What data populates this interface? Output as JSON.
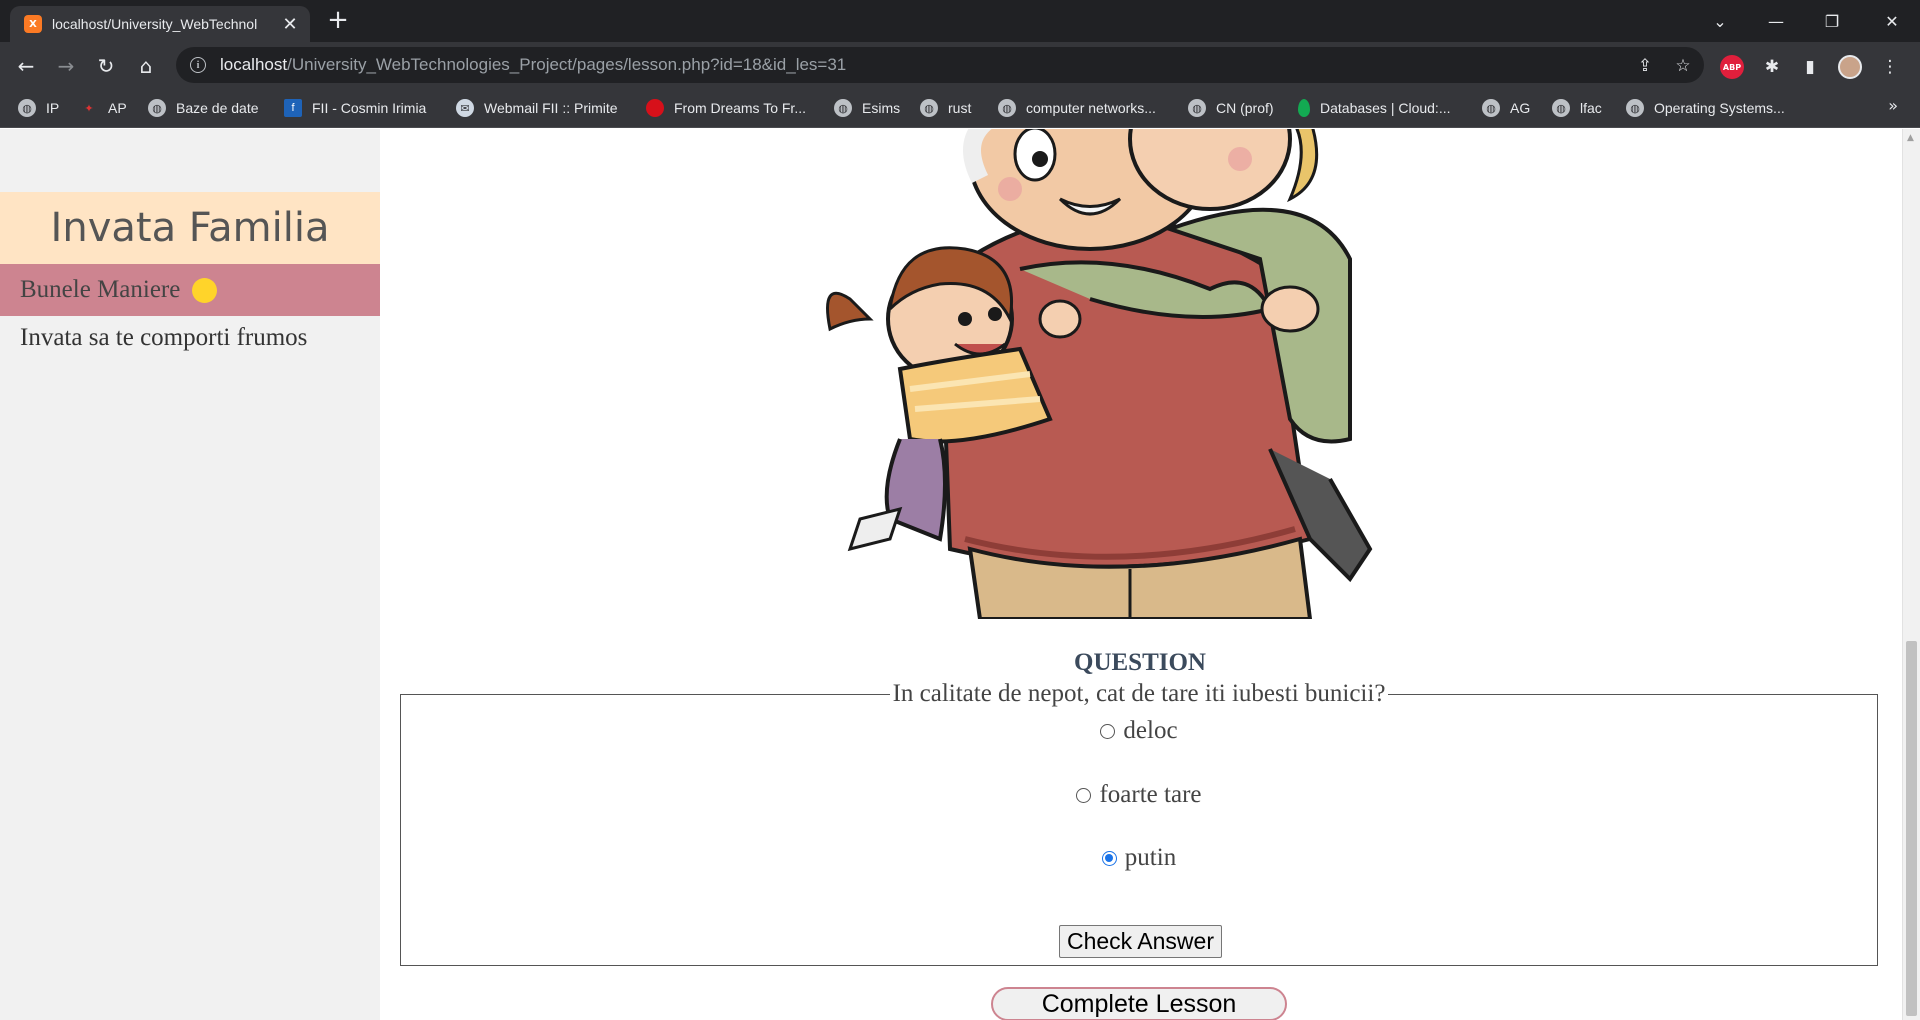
{
  "browser": {
    "tab_title": "localhost/University_WebTechnol",
    "tab_favicon": "xampp-icon",
    "url_host": "localhost",
    "url_path": "/University_WebTechnologies_Project/pages/lesson.php?id=18&id_les=31"
  },
  "bookmarks": [
    {
      "label": "IP",
      "icon": "globe-icon"
    },
    {
      "label": "AP",
      "icon": "figure-icon"
    },
    {
      "label": "Baze de date",
      "icon": "globe-icon"
    },
    {
      "label": "FII - Cosmin Irimia",
      "icon": "fii-icon"
    },
    {
      "label": "Webmail FII :: Primite",
      "icon": "webmail-icon"
    },
    {
      "label": "From Dreams To Fr...",
      "icon": "red-circle-icon"
    },
    {
      "label": "Esims",
      "icon": "globe-icon"
    },
    {
      "label": "rust",
      "icon": "globe-icon"
    },
    {
      "label": "computer networks...",
      "icon": "globe-icon"
    },
    {
      "label": "CN (prof)",
      "icon": "globe-icon"
    },
    {
      "label": "Databases | Cloud:...",
      "icon": "mongodb-icon"
    },
    {
      "label": "AG",
      "icon": "globe-icon"
    },
    {
      "label": "lfac",
      "icon": "globe-icon"
    },
    {
      "label": "Operating Systems...",
      "icon": "globe-icon"
    }
  ],
  "sidebar": {
    "title": "Invata Familia",
    "active_item": "Bunele Maniere",
    "item": "Invata sa te comporti frumos"
  },
  "lesson": {
    "image_alt": "family-hug-illustration",
    "question_heading": "QUESTION",
    "question_text": "In calitate de nepot, cat de tare iti iubesti bunicii?",
    "options": [
      {
        "label": "deloc",
        "checked": false
      },
      {
        "label": "foarte tare",
        "checked": false
      },
      {
        "label": "putin",
        "checked": true
      }
    ],
    "check_button": "Check Answer",
    "complete_button": "Complete Lesson"
  },
  "colors": {
    "sidebar_title_bg": "#ffe4c4",
    "sidebar_active_bg": "#cd8490",
    "active_dot": "#ffd42a",
    "radio_checked": "#1a73e8"
  }
}
